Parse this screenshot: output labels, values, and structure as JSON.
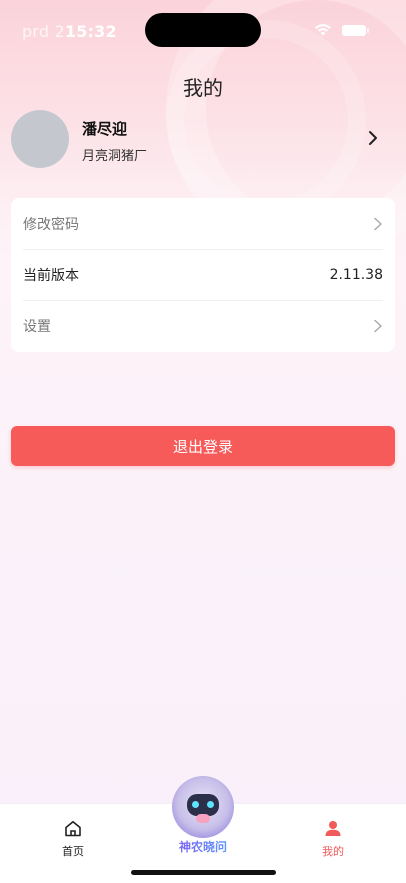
{
  "status_bar": {
    "prefix": "prd 2",
    "time": "15:32"
  },
  "header": {
    "title": "我的"
  },
  "profile": {
    "name": "潘尽迎",
    "org": "月亮洞猪厂"
  },
  "settings": {
    "change_password": "修改密码",
    "current_version_label": "当前版本",
    "current_version_value": "2.11.38",
    "settings_label": "设置"
  },
  "logout": {
    "label": "退出登录"
  },
  "tabbar": {
    "home": "首页",
    "ai": "神农晓问",
    "mine": "我的"
  },
  "colors": {
    "accent": "#f65b5a",
    "tab_active": "#f05a5a"
  }
}
